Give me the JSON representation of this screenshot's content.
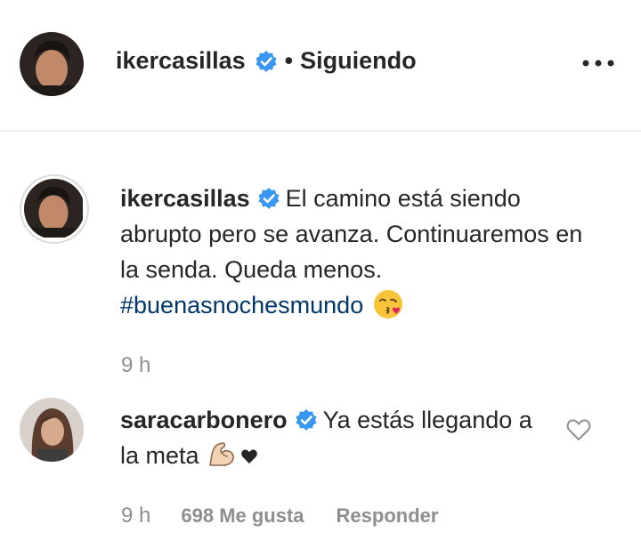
{
  "header": {
    "username": "ikercasillas",
    "separator": "•",
    "follow_status": "Siguiendo",
    "more_icon": "more-horizontal-icon"
  },
  "caption": {
    "username": "ikercasillas",
    "text": "El camino está siendo abrupto pero se avanza. Continuaremos en la senda. Queda menos.",
    "hashtag": "#buenasnochesmundo",
    "emoji_icon": "kissing-face-icon",
    "time": "9 h"
  },
  "comment": {
    "username": "saracarbonero",
    "text": "Ya estás llegando a la meta",
    "emoji_icon": "flexed-biceps-icon",
    "heart_icon": "black-heart-icon",
    "time": "9 h",
    "likes": "698 Me gusta",
    "reply_label": "Responder",
    "like_icon": "heart-outline-icon"
  },
  "colors": {
    "text": "#262626",
    "muted": "#8e8e8e",
    "verified": "#3897f0",
    "hashtag": "#00376b",
    "divider": "#efefef"
  }
}
